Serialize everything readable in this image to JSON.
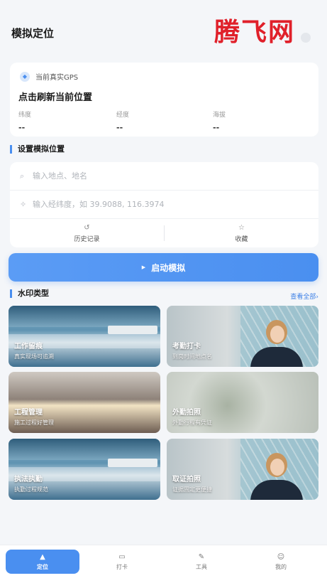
{
  "header": {
    "title": "模拟定位",
    "watermark": "腾飞网"
  },
  "gps": {
    "label": "当前真实GPS",
    "refresh_text": "点击刷新当前位置",
    "latitude_label": "纬度",
    "latitude_value": "--",
    "longitude_label": "经度",
    "longitude_value": "--",
    "altitude_label": "海拔",
    "altitude_value": "--"
  },
  "set_location": {
    "section_title": "设置模拟位置",
    "search_placeholder": "输入地点、地名",
    "coord_placeholder": "输入经纬度，如 39.9088, 116.3974",
    "history_label": "历史记录",
    "favorite_label": "收藏"
  },
  "start_button": {
    "label": "启动模拟"
  },
  "watermark_types": {
    "section_title": "水印类型",
    "see_all": "查看全部›",
    "cards": [
      {
        "title": "工作留痕",
        "subtitle": "真实现场可追溯"
      },
      {
        "title": "考勤打卡",
        "subtitle": "到岗时间地点名"
      },
      {
        "title": "工程管理",
        "subtitle": "施工过程好管理"
      },
      {
        "title": "外勤拍照",
        "subtitle": "外勤行程有凭证"
      },
      {
        "title": "执法执勤",
        "subtitle": "执勤过程规范"
      },
      {
        "title": "取证拍照",
        "subtitle": "证据固定更便捷"
      }
    ]
  },
  "nav": {
    "items": [
      {
        "label": "定位",
        "icon": "location-arrow-icon"
      },
      {
        "label": "打卡",
        "icon": "camera-icon"
      },
      {
        "label": "工具",
        "icon": "pen-icon"
      },
      {
        "label": "我的",
        "icon": "user-icon"
      }
    ]
  },
  "colors": {
    "accent": "#4a8ff0",
    "brand_watermark": "#e0202a",
    "background": "#f4f6f9"
  }
}
